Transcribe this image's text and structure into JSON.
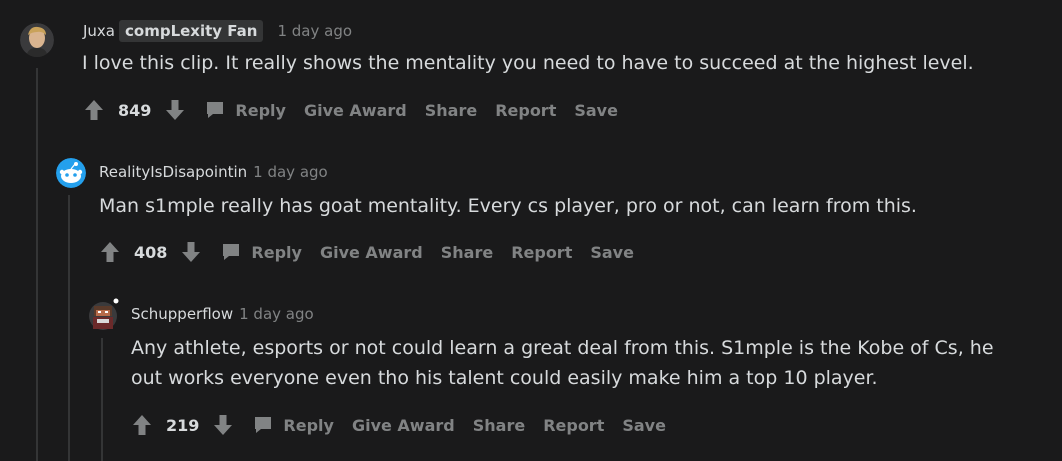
{
  "comments": [
    {
      "author": "Juxa",
      "flair": "compLexity Fan",
      "time": "1 day ago",
      "body": [
        "I love this clip. It really shows the mentality you need to have to succeed at the highest level."
      ],
      "votes": "849",
      "actions": {
        "reply": "Reply",
        "award": "Give Award",
        "share": "Share",
        "report": "Report",
        "save": "Save"
      }
    },
    {
      "author": "RealityIsDisapointin",
      "time": "1 day ago",
      "body": [
        "Man s1mple really has goat mentality. Every cs player, pro or not, can learn from this."
      ],
      "votes": "408",
      "actions": {
        "reply": "Reply",
        "award": "Give Award",
        "share": "Share",
        "report": "Report",
        "save": "Save"
      }
    },
    {
      "author": "Schupperflow",
      "time": "1 day ago",
      "body": [
        "Any athlete, esports or not could learn a great deal from this. S1mple is the Kobe of Cs, he",
        "out works everyone even tho his talent could easily make him a top 10 player."
      ],
      "votes": "219",
      "actions": {
        "reply": "Reply",
        "award": "Give Award",
        "share": "Share",
        "report": "Report",
        "save": "Save"
      }
    }
  ],
  "colors": {
    "background": "#1a1a1b",
    "text": "#d7dadc",
    "muted": "#818384",
    "thread_line": "#343536"
  }
}
